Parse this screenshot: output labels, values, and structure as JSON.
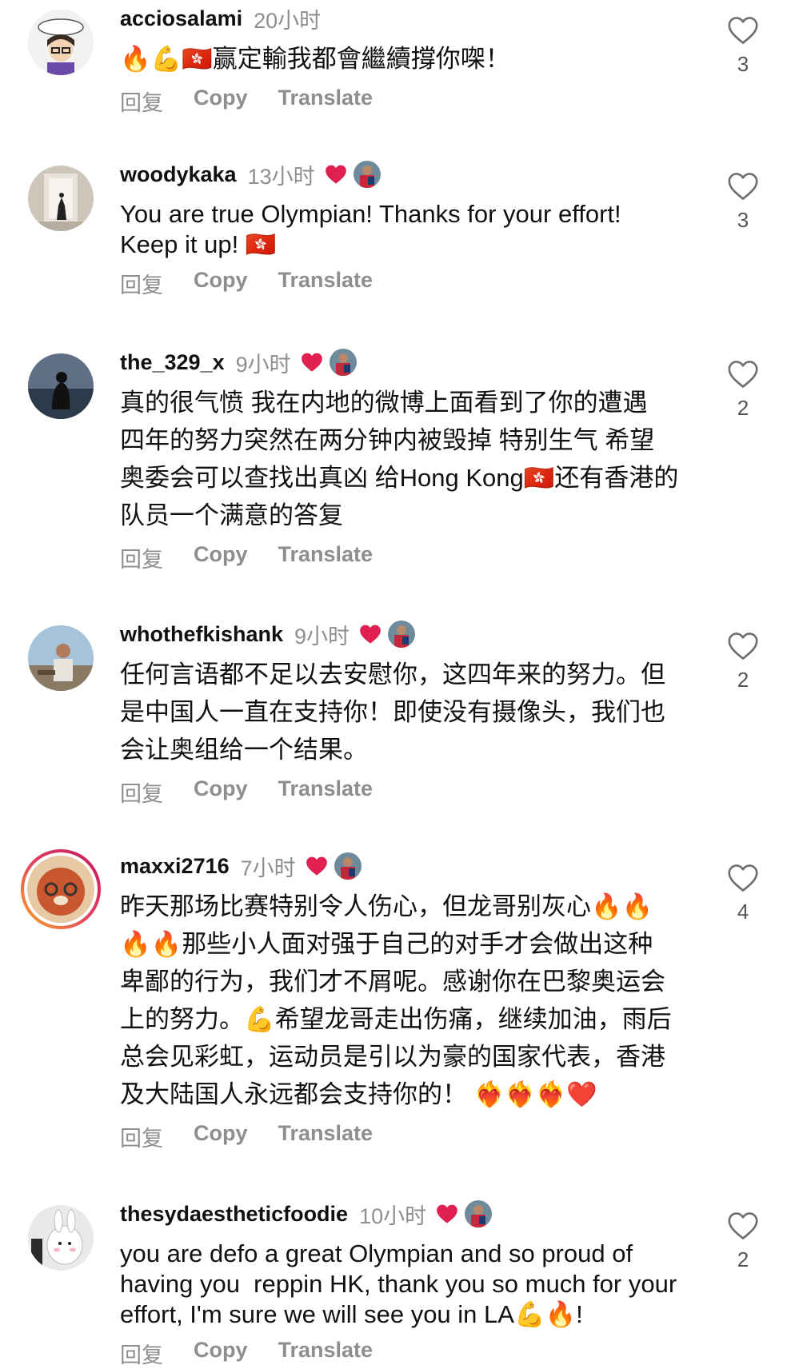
{
  "actions": {
    "reply": "回复",
    "copy": "Copy",
    "translate": "Translate"
  },
  "comments": [
    {
      "username": "acciosalami",
      "time": "20小时",
      "text": "🔥💪🇭🇰赢定輸我都會繼續撐你㗎！",
      "likes": "3",
      "author_liked": false
    },
    {
      "username": "woodykaka",
      "time": "13小时",
      "text": "You are true Olympian! Thanks for your effort!\nKeep it up! 🇭🇰",
      "likes": "3",
      "author_liked": true
    },
    {
      "username": "the_329_x",
      "time": "9小时",
      "text": "真的很气愤 我在内地的微博上面看到了你的遭遇\n四年的努力突然在两分钟内被毁掉 特别生气 希望\n奥委会可以查找出真凶 给Hong Kong🇭🇰还有香港的\n队员一个满意的答复",
      "likes": "2",
      "author_liked": true
    },
    {
      "username": "whothefkishank",
      "time": "9小时",
      "text": "任何言语都不足以去安慰你，这四年来的努力。但\n是中国人一直在支持你！即使没有摄像头，我们也\n会让奥组给一个结果。",
      "likes": "2",
      "author_liked": true
    },
    {
      "username": "maxxi2716",
      "time": "7小时",
      "text": "昨天那场比赛特别令人伤心，但龙哥别灰心🔥🔥\n🔥🔥那些小人面对强于自己的对手才会做出这种\n卑鄙的行为，我们才不屑呢。感谢你在巴黎奥运会\n上的努力。💪希望龙哥走出伤痛，继续加油，雨后\n总会见彩虹，运动员是引以为豪的国家代表，香港\n及大陆国人永远都会支持你的！ ❤️‍🔥❤️‍🔥❤️‍🔥❤️",
      "likes": "4",
      "author_liked": true
    },
    {
      "username": "thesydaestheticfoodie",
      "time": "10小时",
      "text": "you are defo a great Olympian and so proud of\nhaving you  reppin HK, thank you so much for your\neffort, I'm sure we will see you in LA💪🔥!",
      "likes": "2",
      "author_liked": true
    }
  ]
}
